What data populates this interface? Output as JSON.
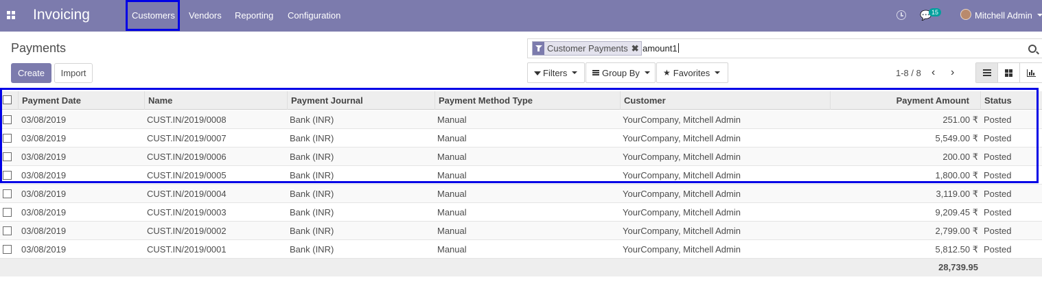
{
  "navbar": {
    "app_name": "Invoicing",
    "menu": [
      "Customers",
      "Vendors",
      "Reporting",
      "Configuration"
    ],
    "messages_count": "15",
    "user_name": "Mitchell Admin",
    "bg_color": "#7c7bad"
  },
  "control_panel": {
    "title": "Payments",
    "create_label": "Create",
    "import_label": "Import",
    "search": {
      "facet_label": "Customer Payments",
      "facet_remove": "✖",
      "input_value": "amount1"
    },
    "filters_label": "Filters",
    "groupby_label": "Group By",
    "favorites_label": "Favorites",
    "pager": "1-8 / 8"
  },
  "table": {
    "columns": [
      "Payment Date",
      "Name",
      "Payment Journal",
      "Payment Method Type",
      "Customer",
      "Payment Amount",
      "Status"
    ],
    "rows": [
      {
        "date": "03/08/2019",
        "name": "CUST.IN/2019/0008",
        "journal": "Bank (INR)",
        "method": "Manual",
        "customer": "YourCompany, Mitchell Admin",
        "amount": "251.00 ₹",
        "status": "Posted"
      },
      {
        "date": "03/08/2019",
        "name": "CUST.IN/2019/0007",
        "journal": "Bank (INR)",
        "method": "Manual",
        "customer": "YourCompany, Mitchell Admin",
        "amount": "5,549.00 ₹",
        "status": "Posted"
      },
      {
        "date": "03/08/2019",
        "name": "CUST.IN/2019/0006",
        "journal": "Bank (INR)",
        "method": "Manual",
        "customer": "YourCompany, Mitchell Admin",
        "amount": "200.00 ₹",
        "status": "Posted"
      },
      {
        "date": "03/08/2019",
        "name": "CUST.IN/2019/0005",
        "journal": "Bank (INR)",
        "method": "Manual",
        "customer": "YourCompany, Mitchell Admin",
        "amount": "1,800.00 ₹",
        "status": "Posted"
      },
      {
        "date": "03/08/2019",
        "name": "CUST.IN/2019/0004",
        "journal": "Bank (INR)",
        "method": "Manual",
        "customer": "YourCompany, Mitchell Admin",
        "amount": "3,119.00 ₹",
        "status": "Posted"
      },
      {
        "date": "03/08/2019",
        "name": "CUST.IN/2019/0003",
        "journal": "Bank (INR)",
        "method": "Manual",
        "customer": "YourCompany, Mitchell Admin",
        "amount": "9,209.45 ₹",
        "status": "Posted"
      },
      {
        "date": "03/08/2019",
        "name": "CUST.IN/2019/0002",
        "journal": "Bank (INR)",
        "method": "Manual",
        "customer": "YourCompany, Mitchell Admin",
        "amount": "2,799.00 ₹",
        "status": "Posted"
      },
      {
        "date": "03/08/2019",
        "name": "CUST.IN/2019/0001",
        "journal": "Bank (INR)",
        "method": "Manual",
        "customer": "YourCompany, Mitchell Admin",
        "amount": "5,812.50 ₹",
        "status": "Posted"
      }
    ],
    "total": "28,739.95"
  },
  "annotation_color": "#0000e6"
}
